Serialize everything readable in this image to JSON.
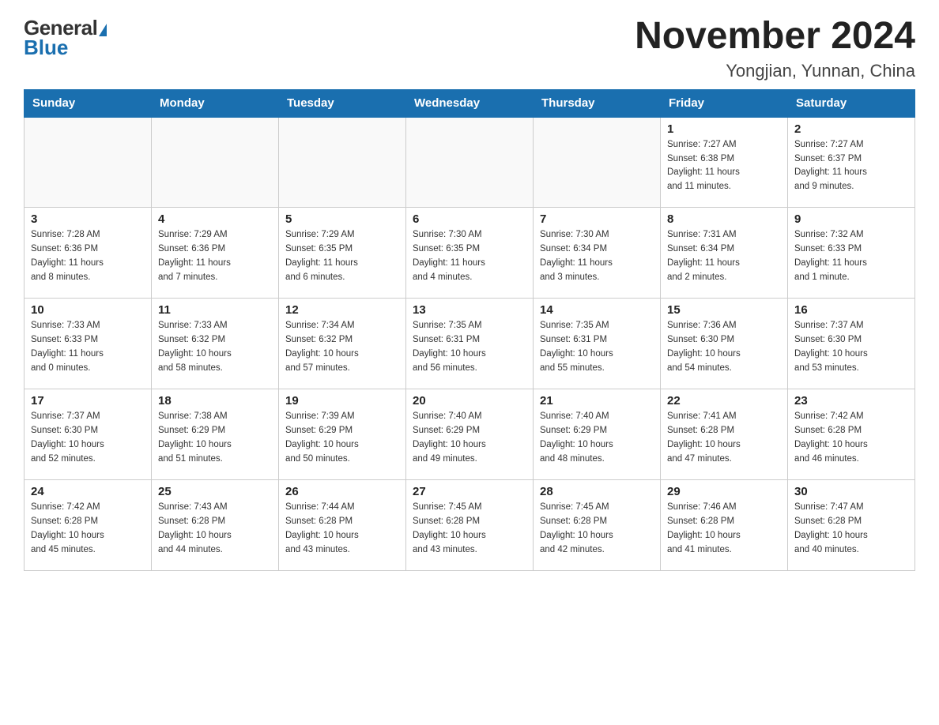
{
  "header": {
    "logo_general": "General",
    "logo_blue": "Blue",
    "month_title": "November 2024",
    "location": "Yongjian, Yunnan, China"
  },
  "days_of_week": [
    "Sunday",
    "Monday",
    "Tuesday",
    "Wednesday",
    "Thursday",
    "Friday",
    "Saturday"
  ],
  "weeks": [
    [
      {
        "day": "",
        "info": ""
      },
      {
        "day": "",
        "info": ""
      },
      {
        "day": "",
        "info": ""
      },
      {
        "day": "",
        "info": ""
      },
      {
        "day": "",
        "info": ""
      },
      {
        "day": "1",
        "info": "Sunrise: 7:27 AM\nSunset: 6:38 PM\nDaylight: 11 hours\nand 11 minutes."
      },
      {
        "day": "2",
        "info": "Sunrise: 7:27 AM\nSunset: 6:37 PM\nDaylight: 11 hours\nand 9 minutes."
      }
    ],
    [
      {
        "day": "3",
        "info": "Sunrise: 7:28 AM\nSunset: 6:36 PM\nDaylight: 11 hours\nand 8 minutes."
      },
      {
        "day": "4",
        "info": "Sunrise: 7:29 AM\nSunset: 6:36 PM\nDaylight: 11 hours\nand 7 minutes."
      },
      {
        "day": "5",
        "info": "Sunrise: 7:29 AM\nSunset: 6:35 PM\nDaylight: 11 hours\nand 6 minutes."
      },
      {
        "day": "6",
        "info": "Sunrise: 7:30 AM\nSunset: 6:35 PM\nDaylight: 11 hours\nand 4 minutes."
      },
      {
        "day": "7",
        "info": "Sunrise: 7:30 AM\nSunset: 6:34 PM\nDaylight: 11 hours\nand 3 minutes."
      },
      {
        "day": "8",
        "info": "Sunrise: 7:31 AM\nSunset: 6:34 PM\nDaylight: 11 hours\nand 2 minutes."
      },
      {
        "day": "9",
        "info": "Sunrise: 7:32 AM\nSunset: 6:33 PM\nDaylight: 11 hours\nand 1 minute."
      }
    ],
    [
      {
        "day": "10",
        "info": "Sunrise: 7:33 AM\nSunset: 6:33 PM\nDaylight: 11 hours\nand 0 minutes."
      },
      {
        "day": "11",
        "info": "Sunrise: 7:33 AM\nSunset: 6:32 PM\nDaylight: 10 hours\nand 58 minutes."
      },
      {
        "day": "12",
        "info": "Sunrise: 7:34 AM\nSunset: 6:32 PM\nDaylight: 10 hours\nand 57 minutes."
      },
      {
        "day": "13",
        "info": "Sunrise: 7:35 AM\nSunset: 6:31 PM\nDaylight: 10 hours\nand 56 minutes."
      },
      {
        "day": "14",
        "info": "Sunrise: 7:35 AM\nSunset: 6:31 PM\nDaylight: 10 hours\nand 55 minutes."
      },
      {
        "day": "15",
        "info": "Sunrise: 7:36 AM\nSunset: 6:30 PM\nDaylight: 10 hours\nand 54 minutes."
      },
      {
        "day": "16",
        "info": "Sunrise: 7:37 AM\nSunset: 6:30 PM\nDaylight: 10 hours\nand 53 minutes."
      }
    ],
    [
      {
        "day": "17",
        "info": "Sunrise: 7:37 AM\nSunset: 6:30 PM\nDaylight: 10 hours\nand 52 minutes."
      },
      {
        "day": "18",
        "info": "Sunrise: 7:38 AM\nSunset: 6:29 PM\nDaylight: 10 hours\nand 51 minutes."
      },
      {
        "day": "19",
        "info": "Sunrise: 7:39 AM\nSunset: 6:29 PM\nDaylight: 10 hours\nand 50 minutes."
      },
      {
        "day": "20",
        "info": "Sunrise: 7:40 AM\nSunset: 6:29 PM\nDaylight: 10 hours\nand 49 minutes."
      },
      {
        "day": "21",
        "info": "Sunrise: 7:40 AM\nSunset: 6:29 PM\nDaylight: 10 hours\nand 48 minutes."
      },
      {
        "day": "22",
        "info": "Sunrise: 7:41 AM\nSunset: 6:28 PM\nDaylight: 10 hours\nand 47 minutes."
      },
      {
        "day": "23",
        "info": "Sunrise: 7:42 AM\nSunset: 6:28 PM\nDaylight: 10 hours\nand 46 minutes."
      }
    ],
    [
      {
        "day": "24",
        "info": "Sunrise: 7:42 AM\nSunset: 6:28 PM\nDaylight: 10 hours\nand 45 minutes."
      },
      {
        "day": "25",
        "info": "Sunrise: 7:43 AM\nSunset: 6:28 PM\nDaylight: 10 hours\nand 44 minutes."
      },
      {
        "day": "26",
        "info": "Sunrise: 7:44 AM\nSunset: 6:28 PM\nDaylight: 10 hours\nand 43 minutes."
      },
      {
        "day": "27",
        "info": "Sunrise: 7:45 AM\nSunset: 6:28 PM\nDaylight: 10 hours\nand 43 minutes."
      },
      {
        "day": "28",
        "info": "Sunrise: 7:45 AM\nSunset: 6:28 PM\nDaylight: 10 hours\nand 42 minutes."
      },
      {
        "day": "29",
        "info": "Sunrise: 7:46 AM\nSunset: 6:28 PM\nDaylight: 10 hours\nand 41 minutes."
      },
      {
        "day": "30",
        "info": "Sunrise: 7:47 AM\nSunset: 6:28 PM\nDaylight: 10 hours\nand 40 minutes."
      }
    ]
  ]
}
